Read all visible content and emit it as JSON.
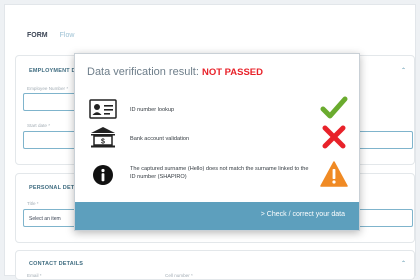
{
  "tabs": [
    {
      "label": "FORM"
    },
    {
      "label": "Flow"
    }
  ],
  "sections": {
    "employment": {
      "title": "EMPLOYMENT D"
    },
    "personal": {
      "title": "PERSONAL DET"
    },
    "contact": {
      "title": "CONTACT DETAILS"
    }
  },
  "fields": {
    "employee_number": {
      "label": "Employee Number *"
    },
    "start_date": {
      "label": "Start date *"
    },
    "title": {
      "label": "Title *",
      "value": "Select an item"
    },
    "contact_left": {
      "label": "Email *"
    },
    "contact_right": {
      "label": "Cell number *"
    }
  },
  "modal": {
    "title": "Data verification result:",
    "status": "NOT PASSED",
    "rows": [
      {
        "text": "ID number lookup",
        "icon": "id-card-icon",
        "status_icon": "check-icon",
        "status": "pass"
      },
      {
        "text": "Bank account validation",
        "icon": "bank-icon",
        "status_icon": "cross-icon",
        "status": "fail"
      },
      {
        "text": "The captured surname (Hello) does not match the surname linked to the ID number (SHAPIRO)",
        "icon": "info-icon",
        "status_icon": "warning-icon",
        "status": "warning"
      }
    ],
    "action": "> Check / correct your data"
  },
  "colors": {
    "accent": "#5d9fbd",
    "pass": "#6aab2e",
    "fail": "#e8222a",
    "warning": "#f08a24",
    "status_text": "#e8222a"
  }
}
